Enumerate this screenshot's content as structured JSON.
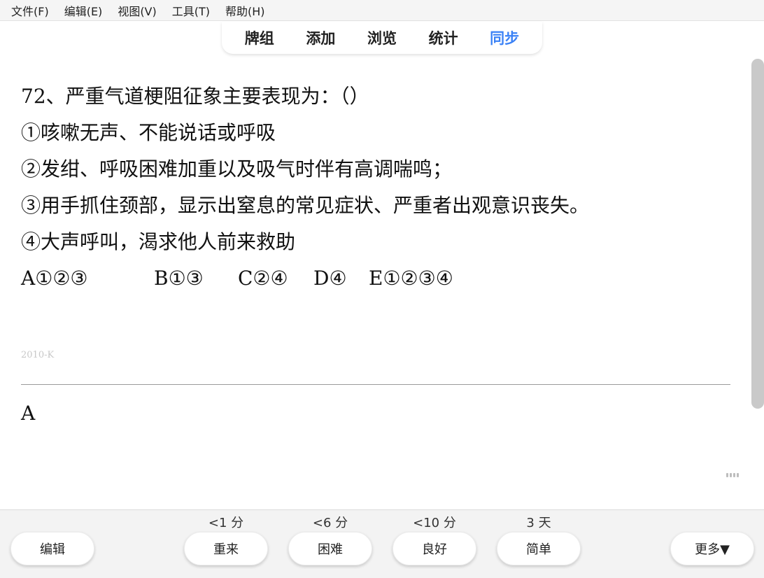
{
  "menu": {
    "items": [
      "文件(F)",
      "编辑(E)",
      "视图(V)",
      "工具(T)",
      "帮助(H)"
    ]
  },
  "toolbar": {
    "tabs": [
      "牌组",
      "添加",
      "浏览",
      "统计",
      "同步"
    ],
    "accent_tab": "同步",
    "accent_color": "#3b82f6"
  },
  "card": {
    "question": "72、严重气道梗阻征象主要表现为：（）",
    "items": [
      "①咳嗽无声、不能说话或呼吸",
      "②发绀、呼吸困难加重以及吸气时伴有高调喘鸣；",
      "③用手抓住颈部，显示出窒息的常见症状、严重者出观意识丧失。",
      "④大声呼叫，渴求他人前来救助"
    ],
    "options": [
      "A①②③",
      "B①③",
      "C②④",
      "D④",
      "E①②③④"
    ],
    "tag": "2010-K",
    "answer": "A"
  },
  "answer_buttons": {
    "edit_label": "编辑",
    "more_label": "更多▼",
    "choices": [
      {
        "interval": "<1 分",
        "label": "重来"
      },
      {
        "interval": "<6 分",
        "label": "困难"
      },
      {
        "interval": "<10 分",
        "label": "良好"
      },
      {
        "interval": "3 天",
        "label": "简单"
      }
    ]
  }
}
